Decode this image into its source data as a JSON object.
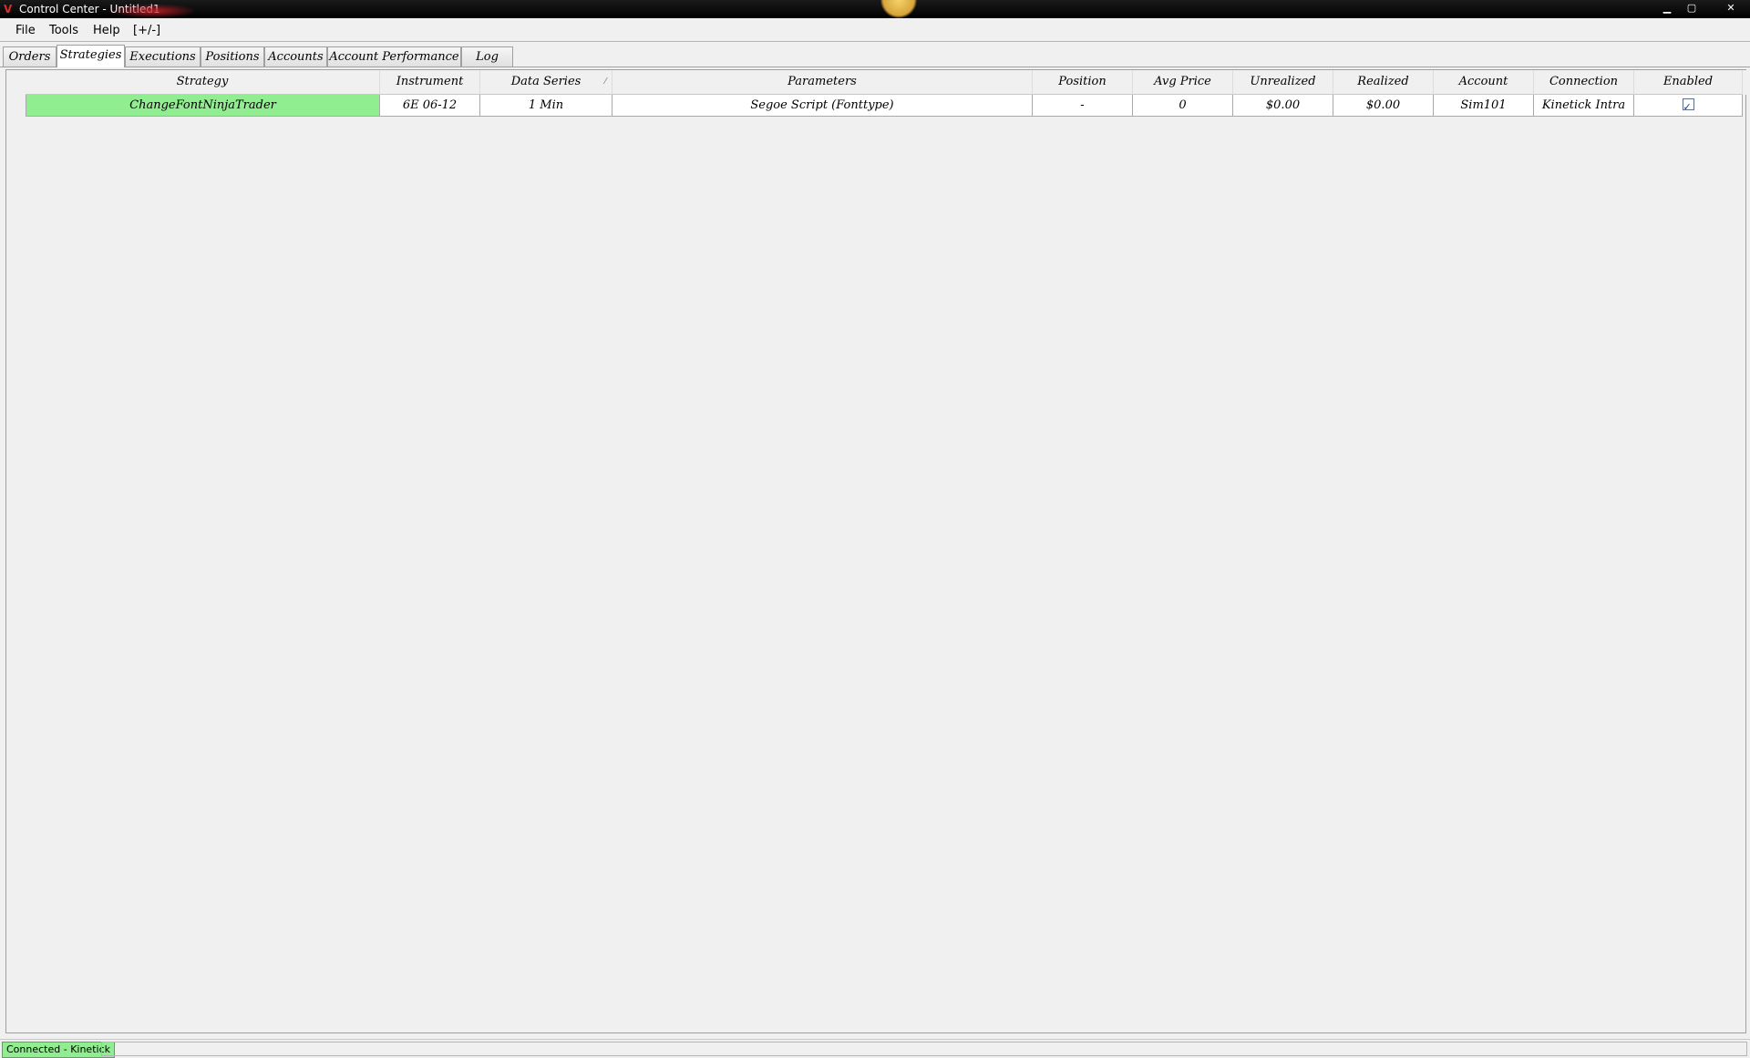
{
  "window": {
    "title": "Control Center - Untitled1",
    "icon": "ninjatrader-logo-icon",
    "controls": {
      "minimize": "▁",
      "maximize": "▢",
      "close": "✕"
    }
  },
  "menu": {
    "file": "File",
    "tools": "Tools",
    "help": "Help",
    "toggle": "[+/-]"
  },
  "tabs": [
    {
      "label": "Orders"
    },
    {
      "label": "Strategies"
    },
    {
      "label": "Executions"
    },
    {
      "label": "Positions"
    },
    {
      "label": "Accounts"
    },
    {
      "label": "Account Performance"
    },
    {
      "label": "Log"
    }
  ],
  "active_tab": "Strategies",
  "grid": {
    "columns": [
      "Strategy",
      "Instrument",
      "Data Series",
      "Parameters",
      "Position",
      "Avg Price",
      "Unrealized",
      "Realized",
      "Account",
      "Connection",
      "Enabled"
    ],
    "sorted_column": "Data Series",
    "rows": [
      {
        "strategy": "ChangeFontNinjaTrader",
        "instrument": "6E 06-12",
        "data_series": "1 Min",
        "parameters": "Segoe Script (Fonttype)",
        "position": "-",
        "avg_price": "0",
        "unrealized": "$0.00",
        "realized": "$0.00",
        "account": "Sim101",
        "connection": "Kinetick Intra",
        "enabled": true
      }
    ],
    "row_highlight_color": "#90ee90"
  },
  "status": {
    "connection": "Connected - Kinetick",
    "connection_color": "#90ee90"
  }
}
